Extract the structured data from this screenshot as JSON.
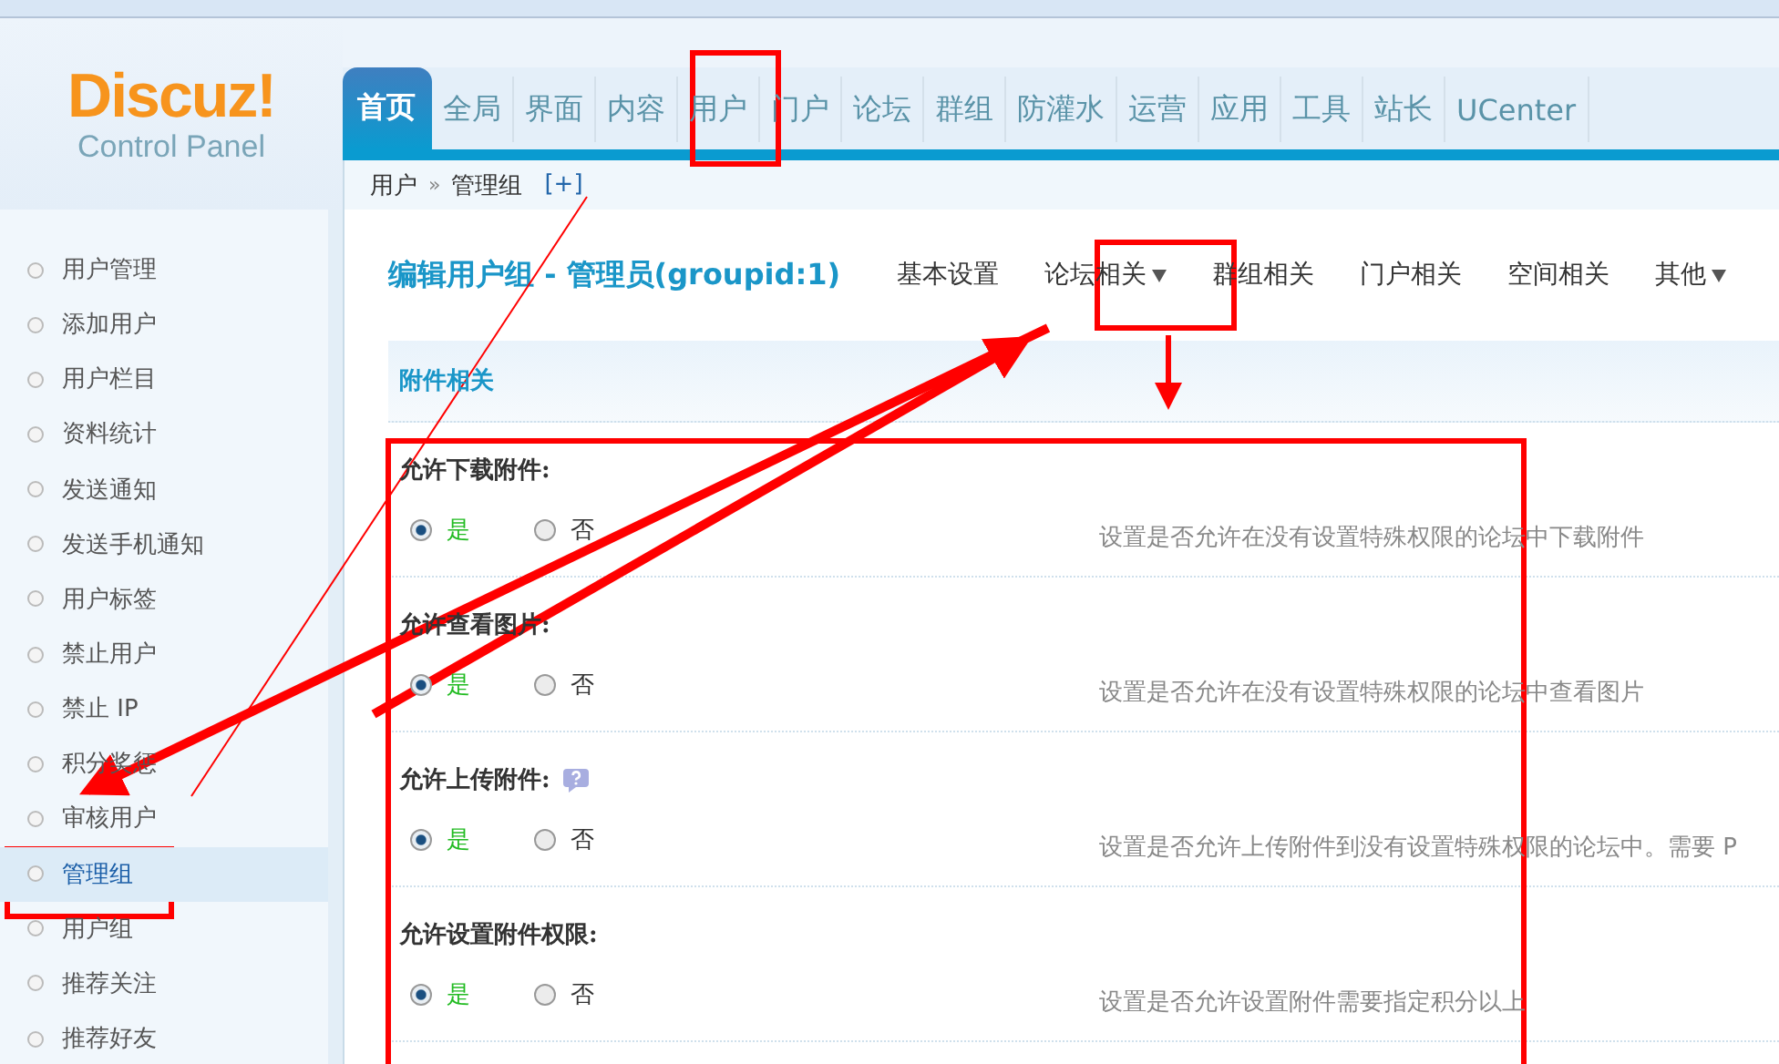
{
  "logo": {
    "title": "Discuz!",
    "subtitle": "Control Panel"
  },
  "nav": [
    {
      "label": "首页",
      "selected": true
    },
    {
      "label": "全局",
      "selected": false
    },
    {
      "label": "界面",
      "selected": false
    },
    {
      "label": "内容",
      "selected": false
    },
    {
      "label": "用户",
      "selected": false
    },
    {
      "label": "门户",
      "selected": false
    },
    {
      "label": "论坛",
      "selected": false
    },
    {
      "label": "群组",
      "selected": false
    },
    {
      "label": "防灌水",
      "selected": false
    },
    {
      "label": "运营",
      "selected": false
    },
    {
      "label": "应用",
      "selected": false
    },
    {
      "label": "工具",
      "selected": false
    },
    {
      "label": "站长",
      "selected": false
    },
    {
      "label": "UCenter",
      "selected": false
    }
  ],
  "breadcrumb": {
    "items": [
      "用户",
      "管理组"
    ],
    "separator": "»",
    "add": "[+]"
  },
  "sidebar": [
    {
      "label": "用户管理",
      "selected": false
    },
    {
      "label": "添加用户",
      "selected": false
    },
    {
      "label": "用户栏目",
      "selected": false
    },
    {
      "label": "资料统计",
      "selected": false
    },
    {
      "label": "发送通知",
      "selected": false
    },
    {
      "label": "发送手机通知",
      "selected": false
    },
    {
      "label": "用户标签",
      "selected": false
    },
    {
      "label": "禁止用户",
      "selected": false
    },
    {
      "label": "禁止 IP",
      "selected": false
    },
    {
      "label": "积分奖惩",
      "selected": false
    },
    {
      "label": "审核用户",
      "selected": false
    },
    {
      "label": "管理组",
      "selected": true
    },
    {
      "label": "用户组",
      "selected": false
    },
    {
      "label": "推荐关注",
      "selected": false
    },
    {
      "label": "推荐好友",
      "selected": false
    }
  ],
  "page_title": "编辑用户组 - 管理员(groupid:1)",
  "subtabs": [
    {
      "label": "基本设置",
      "dropdown": false
    },
    {
      "label": "论坛相关",
      "dropdown": true
    },
    {
      "label": "群组相关",
      "dropdown": false
    },
    {
      "label": "门户相关",
      "dropdown": false
    },
    {
      "label": "空间相关",
      "dropdown": false
    },
    {
      "label": "其他",
      "dropdown": true
    }
  ],
  "section_title": "附件相关",
  "settings": [
    {
      "label": "允许下载附件:",
      "help": false,
      "options": [
        {
          "label": "是",
          "selected": true
        },
        {
          "label": "否",
          "selected": false
        }
      ],
      "description": "设置是否允许在没有设置特殊权限的论坛中下载附件"
    },
    {
      "label": "允许查看图片:",
      "help": false,
      "options": [
        {
          "label": "是",
          "selected": true
        },
        {
          "label": "否",
          "selected": false
        }
      ],
      "description": "设置是否允许在没有设置特殊权限的论坛中查看图片"
    },
    {
      "label": "允许上传附件:",
      "help": true,
      "options": [
        {
          "label": "是",
          "selected": true
        },
        {
          "label": "否",
          "selected": false
        }
      ],
      "description": "设置是否允许上传附件到没有设置特殊权限的论坛中。需要 P"
    },
    {
      "label": "允许设置附件权限:",
      "help": false,
      "options": [
        {
          "label": "是",
          "selected": true
        },
        {
          "label": "否",
          "selected": false
        }
      ],
      "description": "设置是否允许设置附件需要指定积分以上"
    }
  ]
}
